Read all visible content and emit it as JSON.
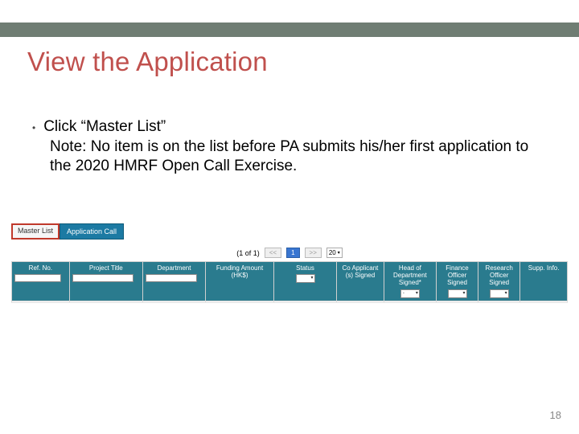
{
  "slide_title": "View the Application",
  "bullet_text": "Click “Master List”",
  "note_text": "Note: No item is on the list before PA submits his/her first application to the 2020 HMRF Open Call Exercise.",
  "tabs": {
    "master": "Master List",
    "app_call": "Application Call"
  },
  "pagination": {
    "summary": "(1 of 1)",
    "prev": "<<",
    "current": "1",
    "next": ">>",
    "page_size": "20"
  },
  "table_headers": {
    "ref_no": "Ref. No.",
    "project_title": "Project Title",
    "department": "Department",
    "funding": "Funding Amount (HK$)",
    "status": "Status",
    "co_applicant": "Co Applicant (s) Signed",
    "hod": "Head of Department Signed*",
    "finance": "Finance Officer Signed",
    "research": "Research Officer Signed",
    "supp": "Supp. Info."
  },
  "page_number": "18"
}
